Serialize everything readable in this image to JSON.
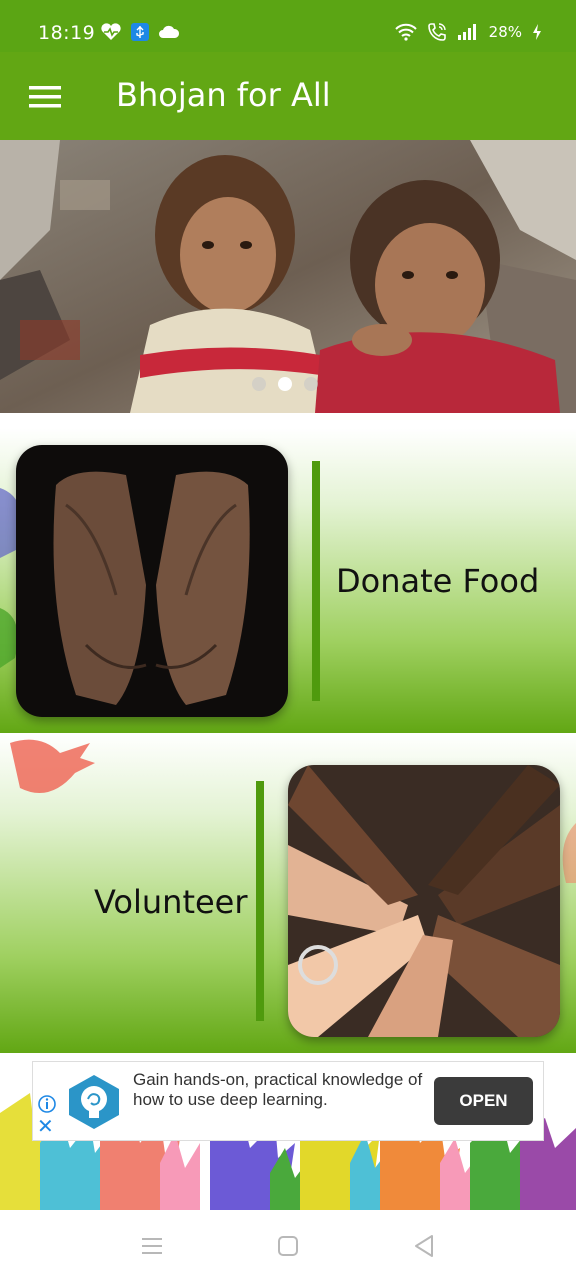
{
  "status_bar": {
    "time": "18:19",
    "battery": "28%",
    "icons": [
      "heart-monitor-icon",
      "usb-icon",
      "cloud-icon",
      "wifi-icon",
      "call-icon",
      "signal-icon",
      "battery-charging-icon"
    ]
  },
  "app_bar": {
    "title": "Bhojan for All",
    "menu_icon": "hamburger-menu-icon"
  },
  "carousel": {
    "slide_count": 3,
    "active_index": 1
  },
  "sections": {
    "donate": {
      "label": "Donate Food"
    },
    "volunteer": {
      "label": "Volunteer"
    }
  },
  "ad": {
    "text": "Gain hands-on, practical knowledge of how to use deep learning.",
    "button_label": "OPEN"
  },
  "nav_bar": {
    "icons": [
      "recents-icon",
      "home-icon",
      "back-icon"
    ]
  },
  "colors": {
    "primary": "#62a714",
    "status_bar": "#5ba514",
    "accent_bar": "#4f9a0d",
    "ad_button": "#3b3b3b"
  }
}
